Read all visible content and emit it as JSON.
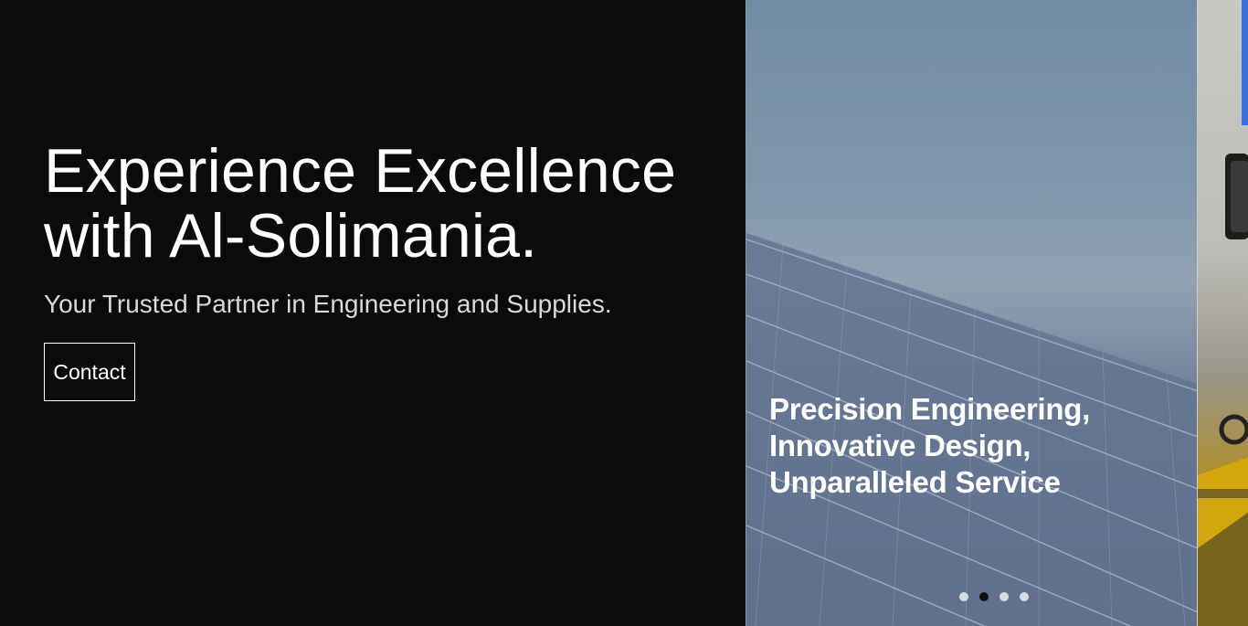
{
  "hero": {
    "title": "Experience Excellence with Al-Solimania.",
    "subtitle": "Your Trusted Partner in Engineering and Supplies.",
    "contact_label": "Contact"
  },
  "slider": {
    "caption": "Precision Engineering, Innovative Design, Unparalleled Service",
    "dots": [
      {
        "active": false
      },
      {
        "active": true
      },
      {
        "active": false
      },
      {
        "active": false
      }
    ]
  },
  "colors": {
    "background": "#0b0b0b",
    "text": "#ffffff",
    "subtitle": "#d9d9d9",
    "accent": "#3b6fe0"
  }
}
